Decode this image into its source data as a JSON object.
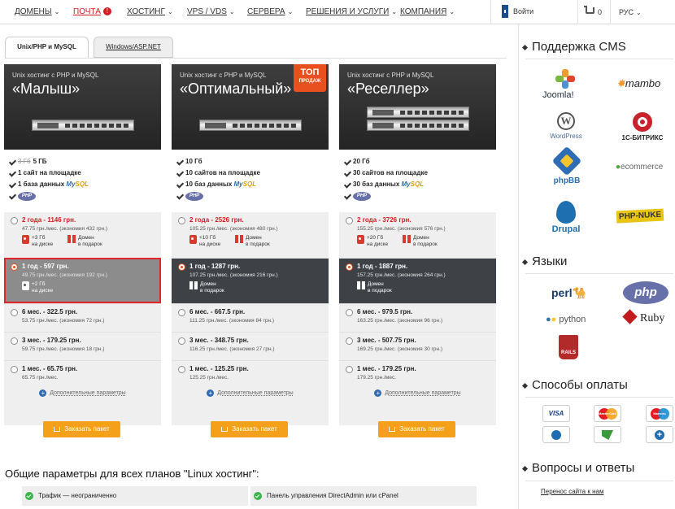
{
  "nav": {
    "items": [
      "ДОМЕНЫ",
      "ПОЧТА",
      "ХОСТИНГ",
      "VPS / VDS",
      "СЕРВЕРА",
      "РЕШЕНИЯ И УСЛУГИ",
      "КОМПАНИЯ"
    ],
    "mail_badge": "!",
    "login": "Войти",
    "cart_count": "0",
    "lang": "РУС"
  },
  "tabs": [
    "Unix/PHP и MySQL",
    "Windows/ASP.NET"
  ],
  "plans": [
    {
      "subtitle": "Unix хостинг с PHP и MySQL",
      "name": "«Малыш»",
      "disk_old": "3 Гб",
      "disk": "5 ГБ",
      "sites": "1 сайт на площадке",
      "db_prefix": "1 база данных",
      "options": [
        {
          "title": "2 года - 1146 грн.",
          "note": "47.75 грн./мес. (экономия 432 грн.)",
          "bonus1": "+3 Гб\nна диске",
          "bonus2": "Домен\nв подарок"
        },
        {
          "title": "1 год - 597 грн.",
          "note": "49.75 грн./мес. (экономия 192 грн.)",
          "bonus1": "+2 Гб\nна диске"
        },
        {
          "title": "6 мес. - 322.5 грн.",
          "note": "53.75 грн./мес. (экономия 72 грн.)"
        },
        {
          "title": "3 мес. - 179.25 грн.",
          "note": "59.75 грн./мес. (экономия 18 грн.)"
        },
        {
          "title": "1 мес. - 65.75 грн.",
          "note": "65.75 грн./мес."
        }
      ]
    },
    {
      "subtitle": "Unix хостинг с PHP и MySQL",
      "name": "«Оптимальный»",
      "badge_top": "ТОП",
      "badge_bottom": "ПРОДАЖ",
      "disk": "10 Гб",
      "sites": "10 сайтов на площадке",
      "db_prefix": "10 баз данных",
      "options": [
        {
          "title": "2 года - 2526 грн.",
          "note": "105.25 грн./мес. (экономия 480 грн.)",
          "bonus1": "+10 Гб\nна диске",
          "bonus2": "Домен\nв подарок"
        },
        {
          "title": "1 год - 1287 грн.",
          "note": "107.25 грн./мес. (экономия 216 грн.)",
          "bonus2": "Домен\nв подарок"
        },
        {
          "title": "6 мес. - 667.5 грн.",
          "note": "111.25 грн./мес. (экономия 84 грн.)"
        },
        {
          "title": "3 мес. - 348.75 грн.",
          "note": "116.25 грн./мес. (экономия 27 грн.)"
        },
        {
          "title": "1 мес. - 125.25 грн.",
          "note": "125.25 грн./мес."
        }
      ]
    },
    {
      "subtitle": "Unix хостинг с PHP и MySQL",
      "name": "«Реселлер»",
      "disk": "20 Гб",
      "sites": "30 сайтов на площадке",
      "db_prefix": "30 баз данных",
      "options": [
        {
          "title": "2 года - 3726 грн.",
          "note": "155.25 грн./мес. (экономия 576 грн.)",
          "bonus1": "+20 Гб\nна диске",
          "bonus2": "Домен\nв подарок"
        },
        {
          "title": "1 год - 1887 грн.",
          "note": "157.25 грн./мес. (экономия 264 грн.)",
          "bonus2": "Домен\nв подарок"
        },
        {
          "title": "6 мес. - 979.5 грн.",
          "note": "163.25 грн./мес. (экономия 96 грн.)"
        },
        {
          "title": "3 мес. - 507.75 грн.",
          "note": "169.25 грн./мес. (экономия 30 грн.)"
        },
        {
          "title": "1 мес. - 179.25 грн.",
          "note": "179.25 грн./мес."
        }
      ]
    }
  ],
  "mysql_my": "My",
  "mysql_sql": "SQL",
  "php_logo": "PHP",
  "more_params": "Дополнительные параметры",
  "order_button": "Заказать пакет",
  "general_title": "Общие параметры для всех планов \"Linux хостинг\":",
  "general_params": [
    "Трафик — неограниченно",
    "Панель управления DirectAdmin или cPanel"
  ],
  "sidebar": {
    "cms_title": "Поддержка CMS",
    "cms": [
      "Joomla!",
      "mambo",
      "WordPress",
      "1С-БИТРИКС",
      "ecommerce",
      "phpBB",
      "Drupal",
      "PHP-NUKE"
    ],
    "lang_title": "Языки",
    "langs": [
      "perl",
      "php",
      "python",
      "Ruby",
      "RAILS"
    ],
    "pay_title": "Способы оплаты",
    "pay": [
      "VISA",
      "MasterCard",
      "Maestro"
    ],
    "faq_title": "Вопросы и ответы",
    "faq_link": "Перенос сайта к нам"
  },
  "colors": {
    "accent": "#f5a01b",
    "red": "#d21d23",
    "selected_dark": "#3e4246",
    "selected_gray": "#8c8c8c"
  }
}
